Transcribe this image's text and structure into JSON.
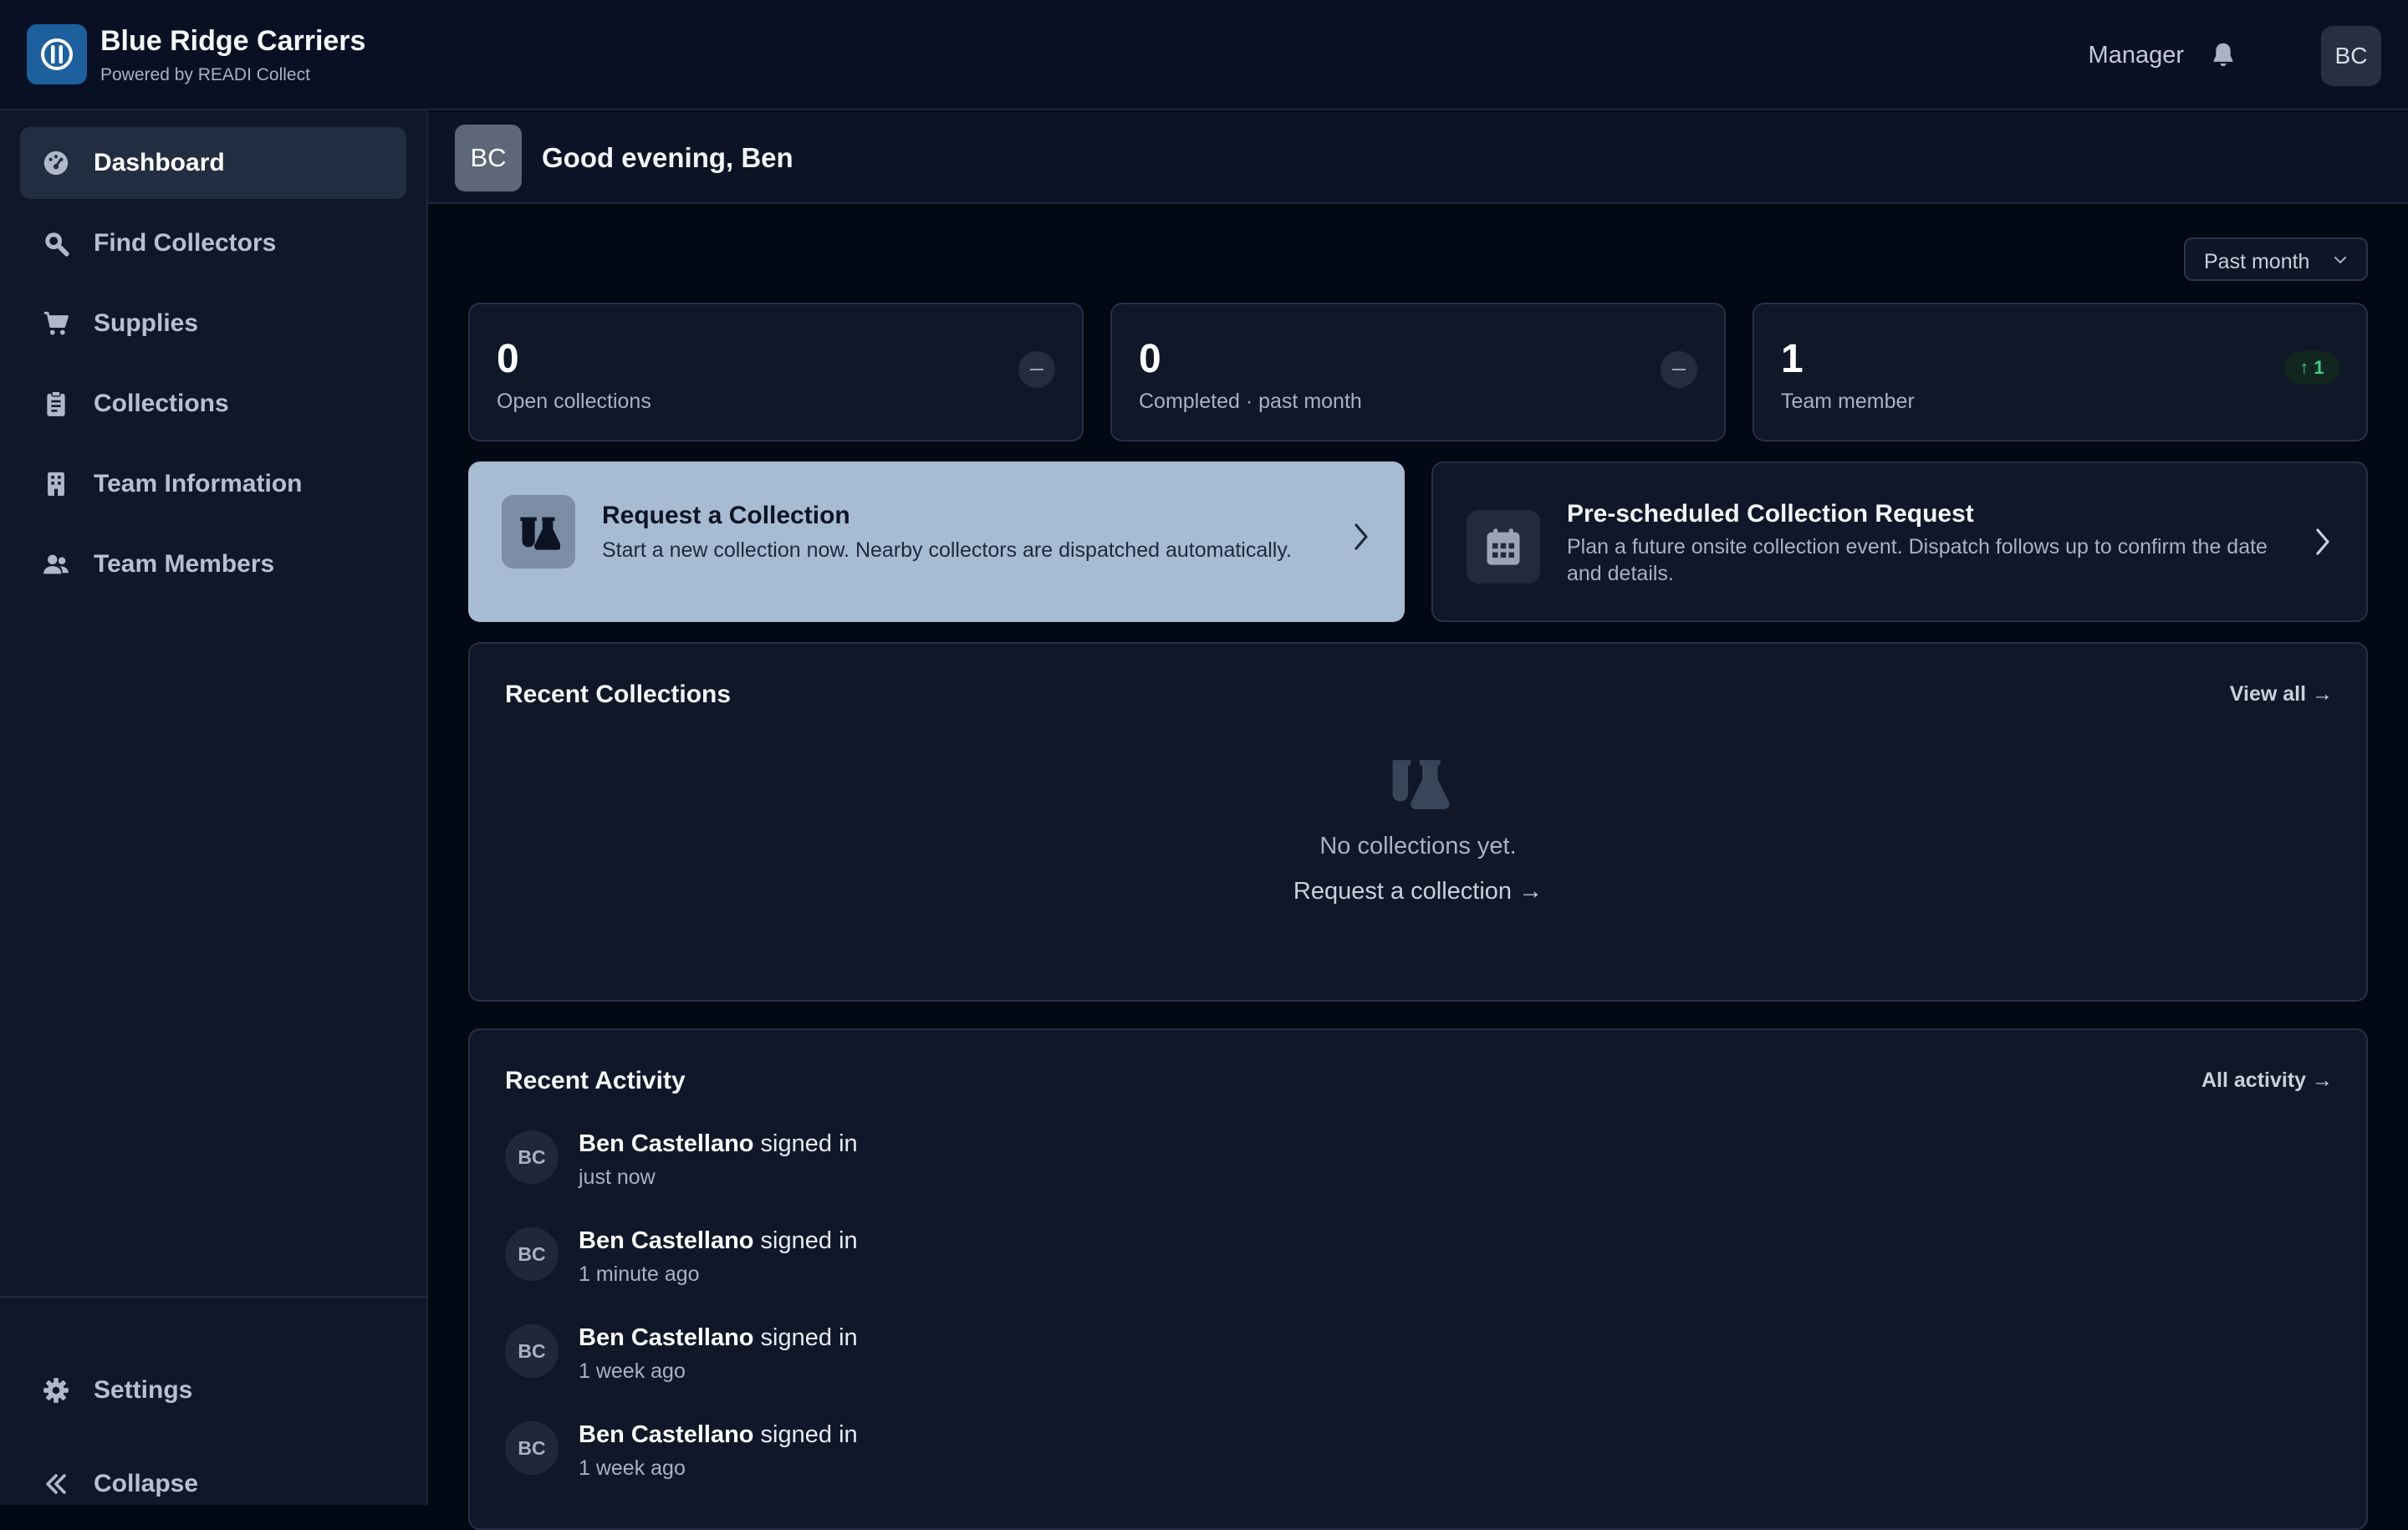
{
  "brand": {
    "name": "Blue Ridge Carriers",
    "subtitle": "Powered by READI Collect"
  },
  "topbar": {
    "role": "Manager",
    "avatar": "BC",
    "notification_icon": "bell-icon"
  },
  "sidebar": {
    "items": [
      {
        "label": "Dashboard",
        "icon": "dashboard-icon",
        "active": true
      },
      {
        "label": "Find Collectors",
        "icon": "search-icon"
      },
      {
        "label": "Supplies",
        "icon": "cart-icon"
      },
      {
        "label": "Collections",
        "icon": "clipboard-icon"
      },
      {
        "label": "Team Information",
        "icon": "building-icon"
      },
      {
        "label": "Team Members",
        "icon": "users-icon"
      }
    ],
    "footer": [
      {
        "label": "Settings",
        "icon": "gear-icon"
      },
      {
        "label": "Collapse",
        "icon": "double-chevron-left-icon"
      }
    ]
  },
  "greeting": {
    "avatar": "BC",
    "text": "Good evening, Ben"
  },
  "period": {
    "selected": "Past month"
  },
  "stats": [
    {
      "value": "0",
      "label": "Open collections",
      "trend": "–"
    },
    {
      "value": "0",
      "label": "Completed · past month",
      "trend": "–"
    },
    {
      "value": "1",
      "label": "Team member",
      "trend": "↑ 1"
    }
  ],
  "actions": {
    "request": {
      "title": "Request a Collection",
      "description": "Start a new collection now. Nearby collectors are dispatched automatically."
    },
    "prescheduled": {
      "title": "Pre-scheduled Collection Request",
      "description": "Plan a future onsite collection event. Dispatch follows up to confirm the date and details."
    }
  },
  "recent_collections": {
    "title": "Recent Collections",
    "view_all": "View all →",
    "empty_text": "No collections yet.",
    "empty_link": "Request a collection →"
  },
  "recent_activity": {
    "title": "Recent Activity",
    "all_link": "All activity →",
    "items": [
      {
        "avatar": "BC",
        "name": "Ben Castellano",
        "action": " signed in",
        "time": "just now"
      },
      {
        "avatar": "BC",
        "name": "Ben Castellano",
        "action": " signed in",
        "time": "1 minute ago"
      },
      {
        "avatar": "BC",
        "name": "Ben Castellano",
        "action": " signed in",
        "time": "1 week ago"
      },
      {
        "avatar": "BC",
        "name": "Ben Castellano",
        "action": " signed in",
        "time": "1 week ago"
      }
    ]
  }
}
